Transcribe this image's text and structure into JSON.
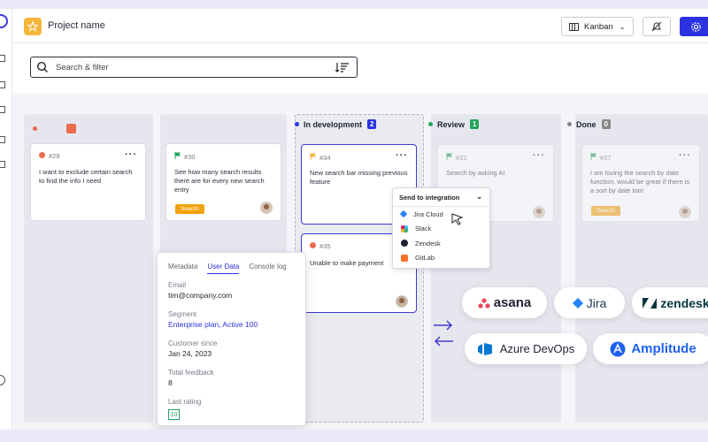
{
  "topbar": {
    "project_name": "Project name",
    "view_label": "Kanban"
  },
  "search": {
    "placeholder": "Search & filter"
  },
  "columns": {
    "in_development": {
      "title": "In development",
      "count": "2",
      "color": "#2b32e0"
    },
    "review": {
      "title": "Review",
      "count": "1",
      "color": "#22a35a"
    },
    "done": {
      "title": "Done",
      "count": "0",
      "color": "#888888"
    }
  },
  "cards": {
    "c29": {
      "id": "#29",
      "text": "I want to exclude certain search to find the info I need"
    },
    "c30": {
      "id": "#30",
      "text": "See how many search results there are for every new search entry",
      "tag": "Search"
    },
    "c34": {
      "id": "#34",
      "text": "New search bar missing previous feature"
    },
    "c35": {
      "id": "#35",
      "text": "Unable to make payment"
    },
    "c32": {
      "id": "#32",
      "text": "Search by asking AI"
    },
    "c37": {
      "id": "#37",
      "text": "I am loving the search by date function, would be great if there is a sort by date too!",
      "tag": "Search"
    }
  },
  "integration_menu": {
    "title": "Send to integration",
    "items": [
      "Jira Cloud",
      "Slack",
      "Zendesk",
      "GitLab"
    ]
  },
  "user_panel": {
    "tabs": [
      "Metadata",
      "User Data",
      "Console log"
    ],
    "active_tab": "User Data",
    "email_label": "Email",
    "email": "tim@company.com",
    "segment_label": "Segment",
    "segment": "Enterprise plan, Active 100",
    "since_label": "Customer since",
    "since": "Jan 24, 2023",
    "feedback_label": "Total feedback",
    "feedback": "8",
    "rating_label": "Last rating",
    "rating": "10"
  },
  "integrations": {
    "asana": "asana",
    "jira": "Jira",
    "zendesk": "zendesk",
    "azure": "Azure DevOps",
    "amplitude": "Amplitude"
  }
}
